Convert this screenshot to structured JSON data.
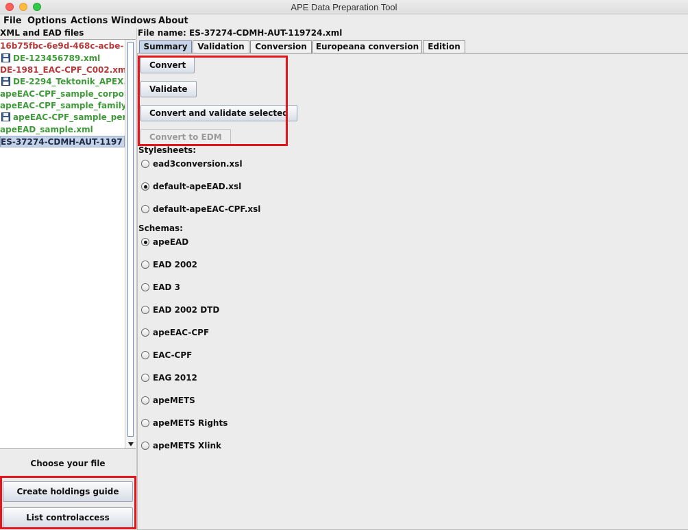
{
  "window": {
    "title": "APE Data Preparation Tool"
  },
  "menu": [
    "File",
    "Options",
    "Actions",
    "Windows",
    "About"
  ],
  "left_panel": {
    "header": "XML and EAD files",
    "files": [
      {
        "name": "16b75fbc-6e9d-468c-acbe-",
        "status": "red",
        "icon": false
      },
      {
        "name": "DE-123456789.xml",
        "status": "green",
        "icon": true
      },
      {
        "name": "DE-1981_EAC-CPF_C002.xm",
        "status": "red",
        "icon": false
      },
      {
        "name": "DE-2294_Tektonik_APEX.:",
        "status": "green",
        "icon": true
      },
      {
        "name": "apeEAC-CPF_sample_corpora",
        "status": "green",
        "icon": false
      },
      {
        "name": "apeEAC-CPF_sample_family.x",
        "status": "green",
        "icon": false
      },
      {
        "name": "apeEAC-CPF_sample_pers",
        "status": "green",
        "icon": true
      },
      {
        "name": "apeEAD_sample.xml",
        "status": "green",
        "icon": false
      },
      {
        "name": "ES-37274-CDMH-AUT-1197",
        "status": "selected",
        "icon": false
      }
    ],
    "choose_label": "Choose your file",
    "buttons": {
      "holdings": "Create holdings guide",
      "controlaccess": "List controlaccess"
    }
  },
  "right_panel": {
    "file_name": "File name: ES-37274-CDMH-AUT-119724.xml",
    "tabs": [
      "Summary",
      "Validation",
      "Conversion",
      "Europeana conversion",
      "Edition"
    ],
    "active_tab": "Summary",
    "actions": {
      "convert": "Convert",
      "validate": "Validate",
      "convert_validate": "Convert and validate selected",
      "convert_edm": "Convert to EDM"
    },
    "stylesheets_label": "Stylesheets:",
    "stylesheets": [
      {
        "label": "ead3conversion.xsl",
        "checked": false
      },
      {
        "label": "default-apeEAD.xsl",
        "checked": true
      },
      {
        "label": "default-apeEAC-CPF.xsl",
        "checked": false
      }
    ],
    "schemas_label": "Schemas:",
    "schemas": [
      {
        "label": "apeEAD",
        "checked": true
      },
      {
        "label": "EAD 2002",
        "checked": false
      },
      {
        "label": "EAD 3",
        "checked": false
      },
      {
        "label": "EAD 2002 DTD",
        "checked": false
      },
      {
        "label": "apeEAC-CPF",
        "checked": false
      },
      {
        "label": "EAC-CPF",
        "checked": false
      },
      {
        "label": "EAG 2012",
        "checked": false
      },
      {
        "label": "apeMETS",
        "checked": false
      },
      {
        "label": "apeMETS Rights",
        "checked": false
      },
      {
        "label": "apeMETS Xlink",
        "checked": false
      }
    ]
  }
}
